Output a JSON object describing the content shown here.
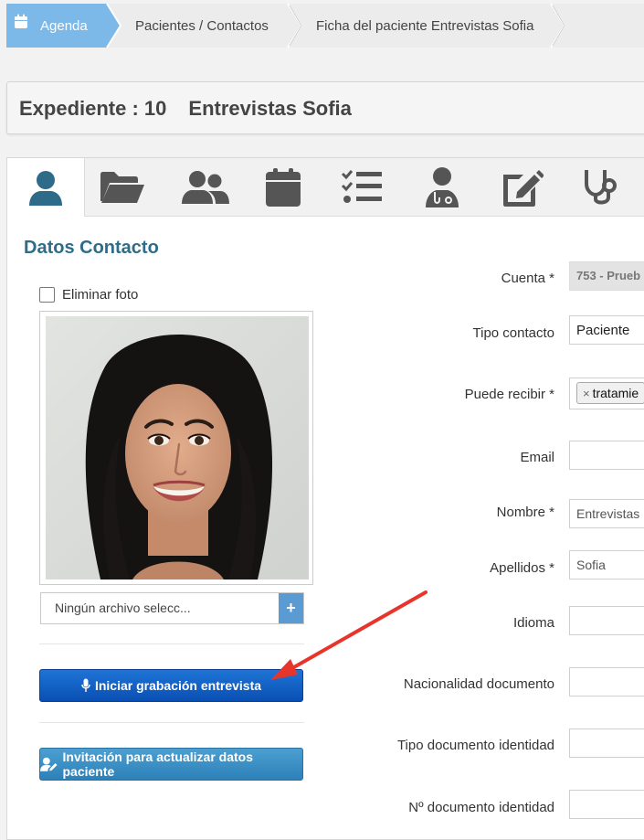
{
  "breadcrumb": {
    "items": [
      "Agenda",
      "Pacientes / Contactos",
      "Ficha del paciente Entrevistas Sofia"
    ]
  },
  "header": {
    "label": "Expediente : 10",
    "name": "Entrevistas Sofia"
  },
  "tabs": [
    "user-icon",
    "folder-icon",
    "users-icon",
    "calendar-icon",
    "checklist-icon",
    "doctor-icon",
    "edit-icon",
    "stethoscope-icon"
  ],
  "section": {
    "title": "Datos Contacto"
  },
  "photo": {
    "delete_label": "Eliminar foto",
    "file_placeholder": "Ningún archivo selecc...",
    "file_button": "+"
  },
  "buttons": {
    "record": "Iniciar grabación entrevista",
    "invite": "Invitación para actualizar datos paciente"
  },
  "form": {
    "cuenta": {
      "label": "Cuenta *",
      "value": "753 - Prueb"
    },
    "tipo_contacto": {
      "label": "Tipo contacto",
      "value": "Paciente"
    },
    "puede_recibir": {
      "label": "Puede recibir *",
      "tag": "tratamie",
      "tag_remove": "×"
    },
    "email": {
      "label": "Email",
      "value": ""
    },
    "nombre": {
      "label": "Nombre *",
      "value": "Entrevistas"
    },
    "apellidos": {
      "label": "Apellidos *",
      "value": "Sofia"
    },
    "idioma": {
      "label": "Idioma",
      "value": ""
    },
    "nacionalidad": {
      "label": "Nacionalidad documento",
      "value": ""
    },
    "tipo_documento": {
      "label": "Tipo documento identidad",
      "value": ""
    },
    "num_documento": {
      "label": "Nº documento identidad",
      "value": ""
    }
  },
  "colors": {
    "breadcrumb_active": "#7cb8e8",
    "section_title": "#2e6d8a",
    "record_button": "#1462c8",
    "invite_button": "#3a8fc4",
    "arrow": "#e8352b"
  }
}
